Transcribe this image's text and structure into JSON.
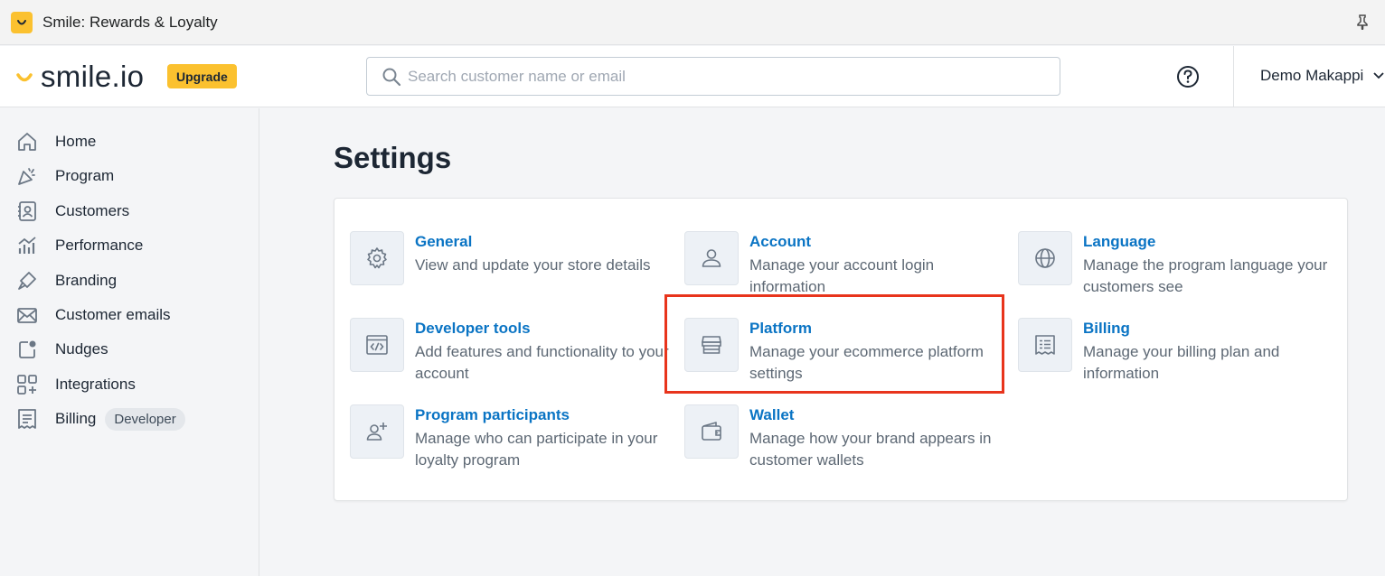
{
  "appbar": {
    "title": "Smile: Rewards & Loyalty"
  },
  "header": {
    "logo_text": "smile.io",
    "upgrade_label": "Upgrade",
    "search_placeholder": "Search customer name or email",
    "user_name": "Demo Makappi"
  },
  "sidebar": {
    "items": [
      {
        "label": "Home",
        "icon": "home-icon"
      },
      {
        "label": "Program",
        "icon": "party-icon"
      },
      {
        "label": "Customers",
        "icon": "contacts-icon"
      },
      {
        "label": "Performance",
        "icon": "chart-icon"
      },
      {
        "label": "Branding",
        "icon": "paint-icon"
      },
      {
        "label": "Customer emails",
        "icon": "email-icon"
      },
      {
        "label": "Nudges",
        "icon": "nudge-icon"
      },
      {
        "label": "Integrations",
        "icon": "apps-icon"
      },
      {
        "label": "Billing",
        "icon": "receipt-icon",
        "badge": "Developer"
      }
    ]
  },
  "main": {
    "title": "Settings",
    "tiles": [
      {
        "title": "General",
        "desc": "View and update your store details",
        "icon": "gear-icon"
      },
      {
        "title": "Account",
        "desc": "Manage your account login information",
        "icon": "person-icon"
      },
      {
        "title": "Language",
        "desc": "Manage the program language your customers see",
        "icon": "globe-icon"
      },
      {
        "title": "Developer tools",
        "desc": "Add features and functionality to your account",
        "icon": "code-icon"
      },
      {
        "title": "Platform",
        "desc": "Manage your ecommerce platform settings",
        "icon": "store-icon"
      },
      {
        "title": "Billing",
        "desc": "Manage your billing plan and information",
        "icon": "receipt-icon"
      },
      {
        "title": "Program participants",
        "desc": "Manage who can participate in your loyalty program",
        "icon": "add-person-icon"
      },
      {
        "title": "Wallet",
        "desc": "Manage how your brand appears in customer wallets",
        "icon": "wallet-icon"
      }
    ]
  },
  "colors": {
    "accent": "#0a74c4",
    "brand": "#fbc12f",
    "highlight": "#e8341c"
  }
}
